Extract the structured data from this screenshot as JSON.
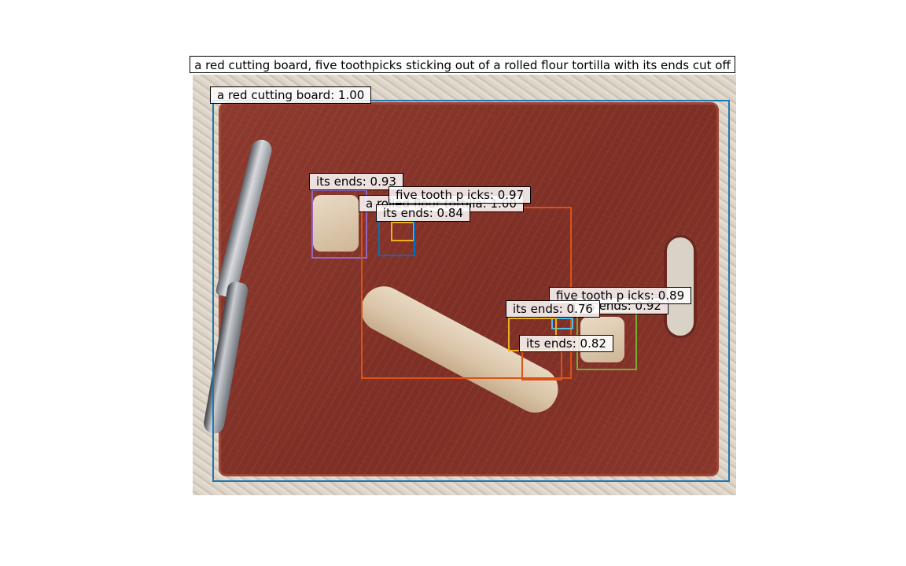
{
  "caption": "a red cutting board, five toothpicks sticking out of a rolled flour tortilla with its ends cut off",
  "detections": [
    {
      "label": "a red cutting board: 1.00",
      "color": "#1f77b4"
    },
    {
      "label": "its ends: 0.93",
      "color": "#9467bd"
    },
    {
      "label": "a rolled flour tortilla: 1.00",
      "color": "#d95319"
    },
    {
      "label": "five tooth p icks: 0.97",
      "color": "#7e2f8e"
    },
    {
      "label": "its ends: 0.84",
      "color": "#0072bd"
    },
    {
      "label": "its ends: 0.92",
      "color": "#77ac30"
    },
    {
      "label": "five tooth p icks: 0.89",
      "color": "#4dbeee"
    },
    {
      "label": "its ends: 0.76",
      "color": "#edb120"
    },
    {
      "label": "its ends: 0.82",
      "color": "#d95319"
    }
  ]
}
